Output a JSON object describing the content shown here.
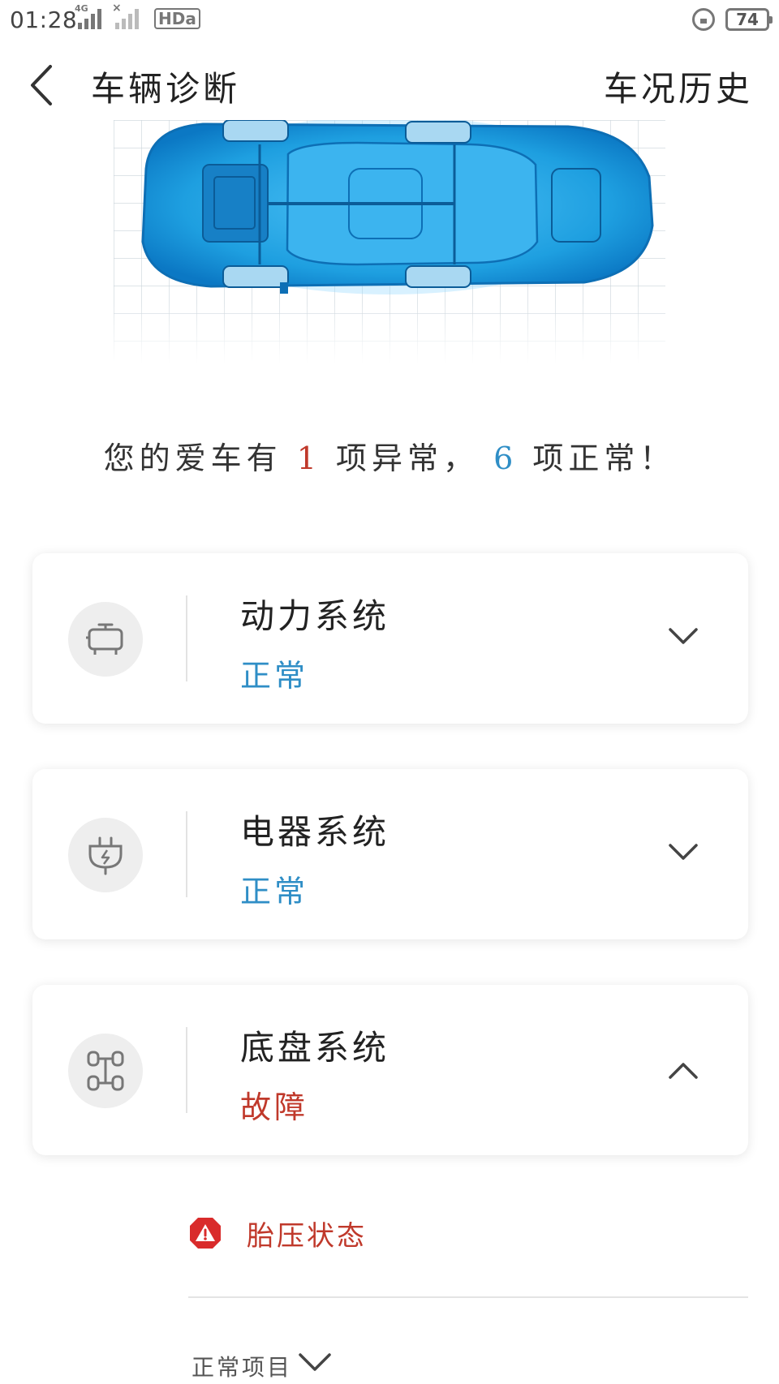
{
  "status_bar": {
    "time": "01:28",
    "network_primary": "4G",
    "network_secondary": "×",
    "hd_label": "HDa",
    "battery": "74"
  },
  "header": {
    "title": "车辆诊断",
    "history_link": "车况历史"
  },
  "summary": {
    "prefix": "您的爱车有",
    "abnormal_count": "1",
    "middle": "项异常，",
    "normal_count": "6",
    "suffix": "项正常！"
  },
  "systems": [
    {
      "name": "动力系统",
      "status": "正常",
      "status_type": "ok",
      "icon": "engine-icon",
      "expanded": false
    },
    {
      "name": "电器系统",
      "status": "正常",
      "status_type": "ok",
      "icon": "plug-icon",
      "expanded": false
    },
    {
      "name": "底盘系统",
      "status": "故障",
      "status_type": "error",
      "icon": "chassis-icon",
      "expanded": true
    }
  ],
  "fault_items": [
    {
      "label": "胎压状态",
      "icon": "warning-icon"
    }
  ],
  "normal_items_toggle": "正常项目",
  "colors": {
    "accent_blue": "#2f8ec6",
    "error_red": "#c0392b",
    "car_blue": "#19a3e6"
  }
}
